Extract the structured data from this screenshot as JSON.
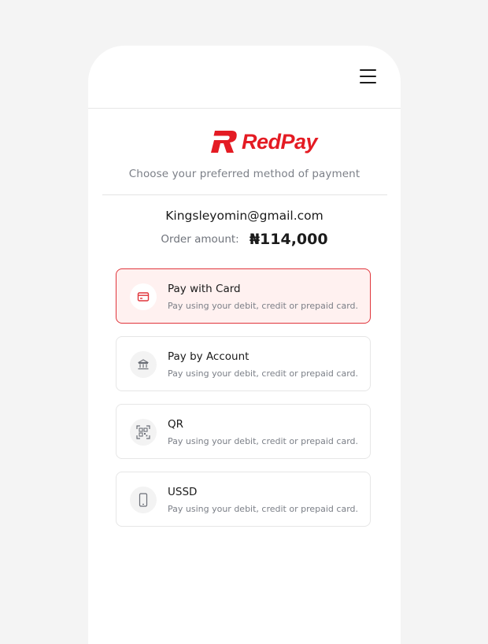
{
  "brand": {
    "name": "RedPay",
    "accent_color": "#e41b23"
  },
  "header": {
    "menu_icon": "hamburger-menu-icon"
  },
  "page": {
    "subtitle": "Choose your preferred method of payment",
    "email": "Kingsleyomin@gmail.com",
    "order_label": "Order amount:",
    "order_value": "₦114,000"
  },
  "options": [
    {
      "title": "Pay with Card",
      "description": "Pay using your debit, credit or prepaid card.",
      "icon": "credit-card-icon",
      "selected": true
    },
    {
      "title": "Pay by Account",
      "description": "Pay using your debit, credit or prepaid card.",
      "icon": "bank-icon",
      "selected": false
    },
    {
      "title": "QR",
      "description": "Pay using your debit, credit or prepaid card.",
      "icon": "qr-code-icon",
      "selected": false
    },
    {
      "title": "USSD",
      "description": "Pay using your debit, credit or prepaid card.",
      "icon": "mobile-phone-icon",
      "selected": false
    }
  ]
}
